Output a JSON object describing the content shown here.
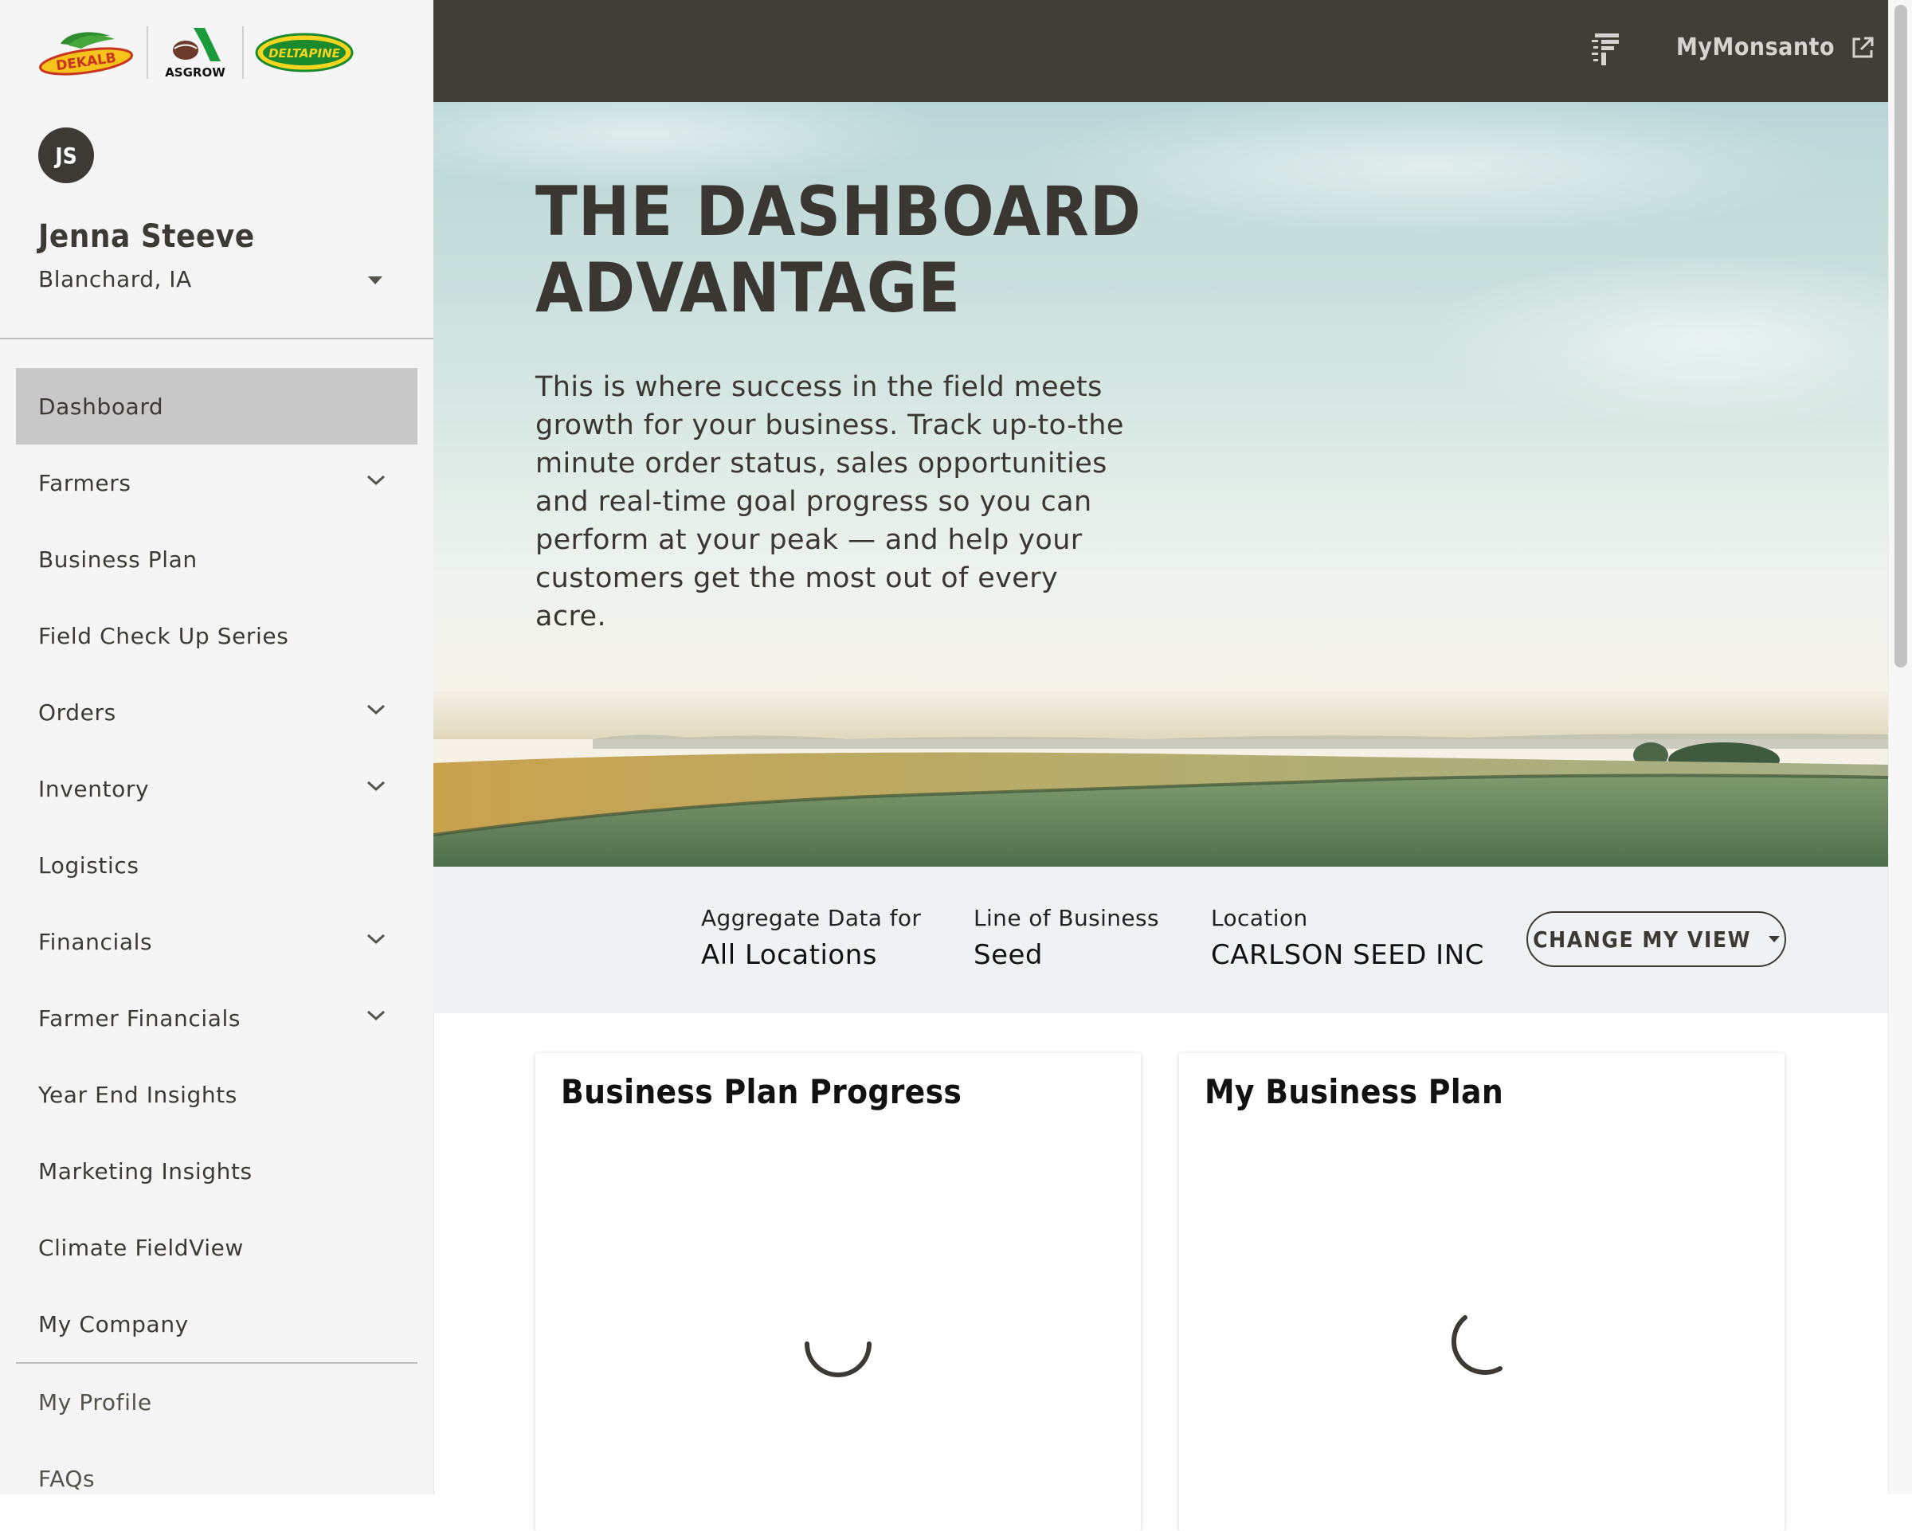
{
  "brands": {
    "dekalb": "DEKALB",
    "asgrow": "ASGROW",
    "deltapine": "DELTAPINE"
  },
  "user": {
    "initials": "JS",
    "name": "Jenna Steeve",
    "location": "Blanchard, IA"
  },
  "nav": {
    "items": [
      {
        "label": "Dashboard",
        "active": true,
        "expandable": false
      },
      {
        "label": "Farmers",
        "expandable": true
      },
      {
        "label": "Business Plan",
        "expandable": false
      },
      {
        "label": "Field Check Up Series",
        "expandable": false
      },
      {
        "label": "Orders",
        "expandable": true
      },
      {
        "label": "Inventory",
        "expandable": true
      },
      {
        "label": "Logistics",
        "expandable": false
      },
      {
        "label": "Financials",
        "expandable": true
      },
      {
        "label": "Farmer Financials",
        "expandable": true
      },
      {
        "label": "Year End Insights",
        "expandable": false
      },
      {
        "label": "Marketing Insights",
        "expandable": false
      },
      {
        "label": "Climate FieldView",
        "expandable": false
      },
      {
        "label": "My Company",
        "expandable": false
      }
    ],
    "secondary": [
      {
        "label": "My Profile"
      },
      {
        "label": "FAQs"
      }
    ]
  },
  "header": {
    "link_label": "MyMonsanto",
    "icons": [
      "fieldview-f-icon",
      "external-link-icon"
    ]
  },
  "hero": {
    "title_line1": "THE DASHBOARD",
    "title_line2": "ADVANTAGE",
    "body": "This is where success in the field meets growth for your business. Track up-to-the minute order status, sales opportunities and real-time goal progress so you can perform at your peak — and help your customers get the most out of every acre."
  },
  "filters": {
    "aggregate": {
      "label": "Aggregate Data for",
      "value": "All Locations"
    },
    "line_of_business": {
      "label": "Line of Business",
      "value": "Seed"
    },
    "location": {
      "label": "Location",
      "value": "CARLSON SEED INC"
    },
    "change_button": "CHANGE MY VIEW"
  },
  "cards": [
    {
      "title": "Business Plan Progress",
      "state": "loading"
    },
    {
      "title": "My Business Plan",
      "state": "loading"
    }
  ],
  "colors": {
    "header_bg": "#413e38",
    "sidebar_bg": "#f5f5f5",
    "active_nav": "#c8c8c8",
    "text_dark": "#3a3631",
    "filter_bg": "#f0f1f3"
  }
}
